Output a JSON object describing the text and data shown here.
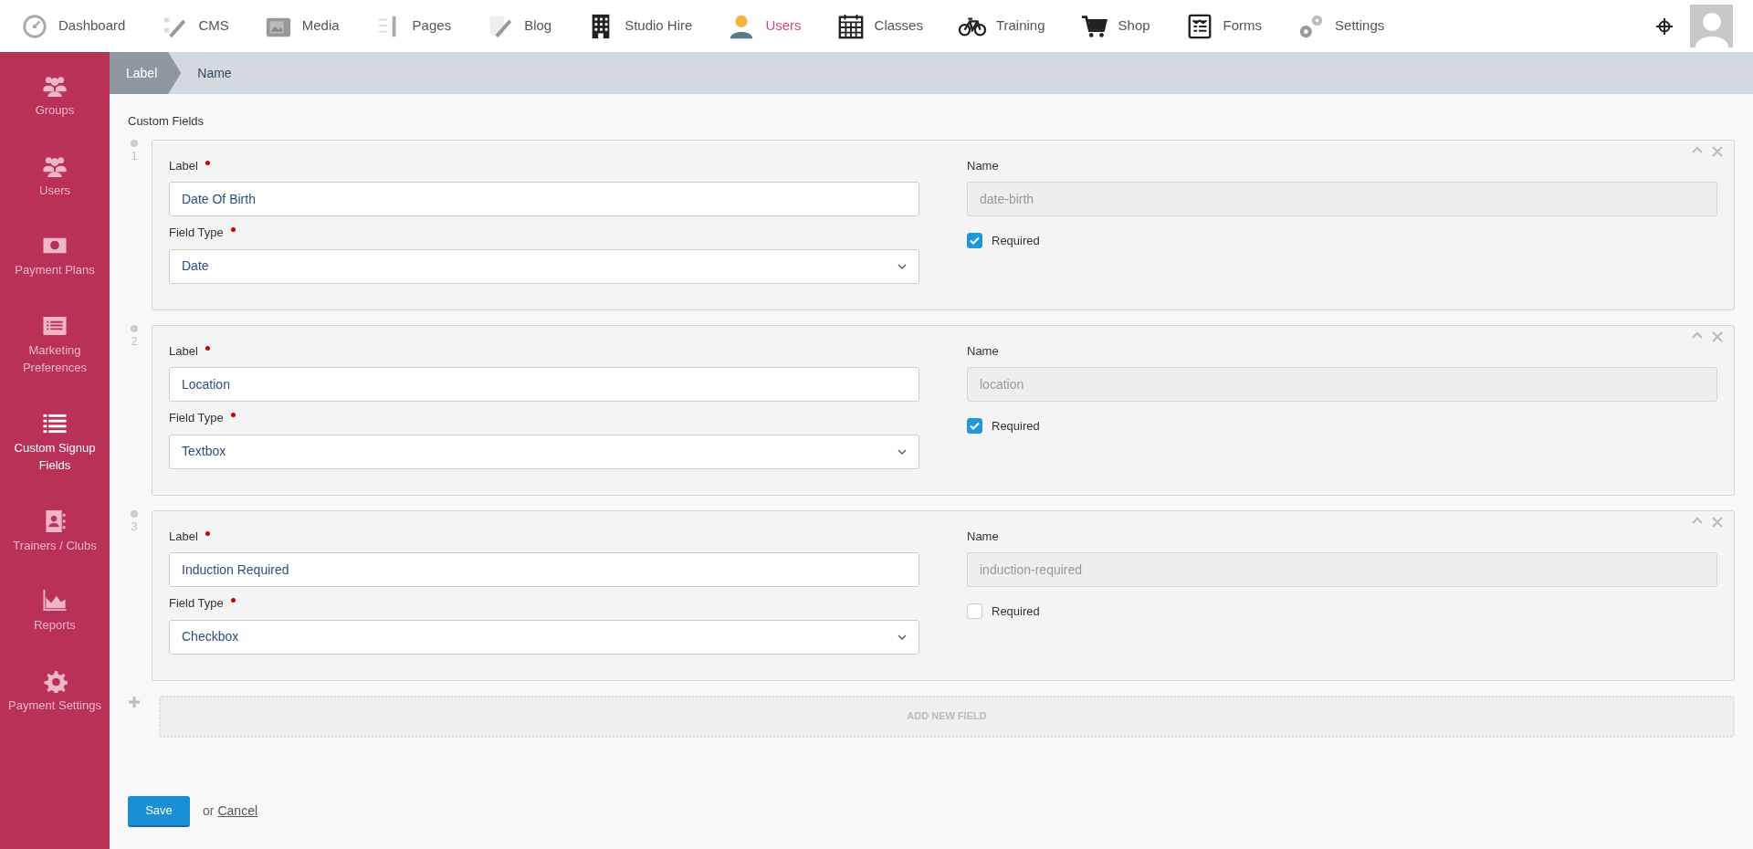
{
  "top_nav": [
    {
      "label": "Dashboard",
      "selected": false
    },
    {
      "label": "CMS",
      "selected": false
    },
    {
      "label": "Media",
      "selected": false
    },
    {
      "label": "Pages",
      "selected": false
    },
    {
      "label": "Blog",
      "selected": false
    },
    {
      "label": "Studio Hire",
      "selected": false
    },
    {
      "label": "Users",
      "selected": true
    },
    {
      "label": "Classes",
      "selected": false
    },
    {
      "label": "Training",
      "selected": false
    },
    {
      "label": "Shop",
      "selected": false
    },
    {
      "label": "Forms",
      "selected": false
    },
    {
      "label": "Settings",
      "selected": false
    }
  ],
  "sidebar": {
    "items": [
      {
        "label": "Groups",
        "selected": false
      },
      {
        "label": "Users",
        "selected": false
      },
      {
        "label": "Payment Plans",
        "selected": false
      },
      {
        "label": "Marketing Preferences",
        "selected": false
      },
      {
        "label": "Custom Signup Fields",
        "selected": true
      },
      {
        "label": "Trainers / Clubs",
        "selected": false
      },
      {
        "label": "Reports",
        "selected": false
      },
      {
        "label": "Payment Settings",
        "selected": false
      }
    ]
  },
  "breadcrumb": [
    {
      "label": "Label",
      "selected": true
    },
    {
      "label": "Name",
      "selected": false
    }
  ],
  "section_title": "Custom Fields",
  "fields": [
    {
      "number": "1",
      "label_caption": "Label",
      "label_value": "Date Of Birth",
      "type_caption": "Field Type",
      "type_value": "Date",
      "name_caption": "Name",
      "name_value": "date-birth",
      "required_label": "Required",
      "required": true
    },
    {
      "number": "2",
      "label_caption": "Label",
      "label_value": "Location",
      "type_caption": "Field Type",
      "type_value": "Textbox",
      "name_caption": "Name",
      "name_value": "location",
      "required_label": "Required",
      "required": true
    },
    {
      "number": "3",
      "label_caption": "Label",
      "label_value": "Induction Required",
      "type_caption": "Field Type",
      "type_value": "Checkbox",
      "name_caption": "Name",
      "name_value": "induction-required",
      "required_label": "Required",
      "required": false
    }
  ],
  "add_field_label": "ADD NEW FIELD",
  "actions": {
    "save": "Save",
    "or": "or",
    "cancel": "Cancel"
  }
}
